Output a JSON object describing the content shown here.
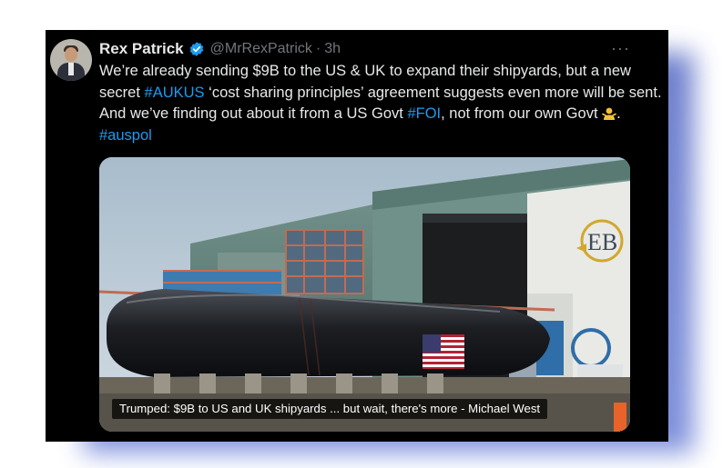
{
  "tweet": {
    "author_name": "Rex Patrick",
    "handle": "@MrRexPatrick",
    "separator": "·",
    "time": "3h",
    "more_label": "···",
    "text": {
      "part1": "We’re already sending $9B to the US & UK to expand their shipyards, but a new secret ",
      "hashtag1": "#AUKUS",
      "part2": " ‘cost sharing principles’ agreement suggests even more will be sent. And we’ve finding out about it from a US Govt ",
      "hashtag2": "#FOI",
      "part3": ", not from our own Govt ",
      "part4": ". ",
      "hashtag3": "#auspol"
    },
    "media": {
      "caption": "Trumped: $9B to US and UK shipyards ... but wait, there's more - Michael West",
      "building_logo": "EB"
    }
  },
  "colors": {
    "card_bg": "#000000",
    "text": "#e7e9ea",
    "muted": "#71767b",
    "link": "#1d9bf0",
    "shadow": "#5569c4"
  },
  "icons": {
    "verified": "verified-badge-icon",
    "emoji": "person-shrugging-emoji"
  }
}
